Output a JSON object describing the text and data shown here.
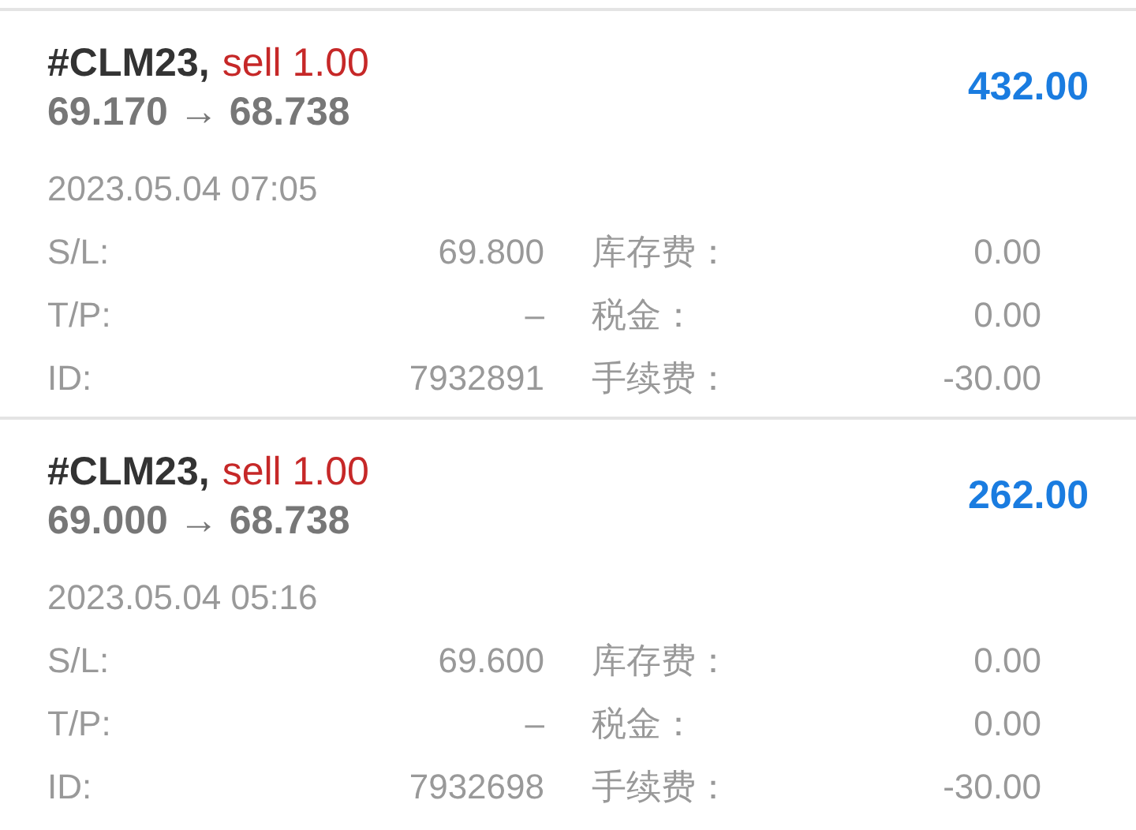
{
  "trades": [
    {
      "symbol": "#CLM23,",
      "side": "sell 1.00",
      "prices": "69.170 → 68.738",
      "profit": "432.00",
      "time": "2023.05.04 07:05",
      "fields": [
        {
          "label": "S/L:",
          "value": "69.800",
          "label_2": "库存费：",
          "value_2": "0.00"
        },
        {
          "label": "T/P:",
          "value": "–",
          "label_2": "税金：",
          "value_2": "0.00"
        },
        {
          "label": "ID:",
          "value": "7932891",
          "label_2": "手续费：",
          "value_2": "-30.00"
        }
      ]
    },
    {
      "symbol": "#CLM23,",
      "side": "sell 1.00",
      "prices": "69.000 → 68.738",
      "profit": "262.00",
      "time": "2023.05.04 05:16",
      "fields": [
        {
          "label": "S/L:",
          "value": "69.600",
          "label_2": "库存费：",
          "value_2": "0.00"
        },
        {
          "label": "T/P:",
          "value": "–",
          "label_2": "税金：",
          "value_2": "0.00"
        },
        {
          "label": "ID:",
          "value": "7932698",
          "label_2": "手续费：",
          "value_2": "-30.00"
        }
      ]
    }
  ]
}
